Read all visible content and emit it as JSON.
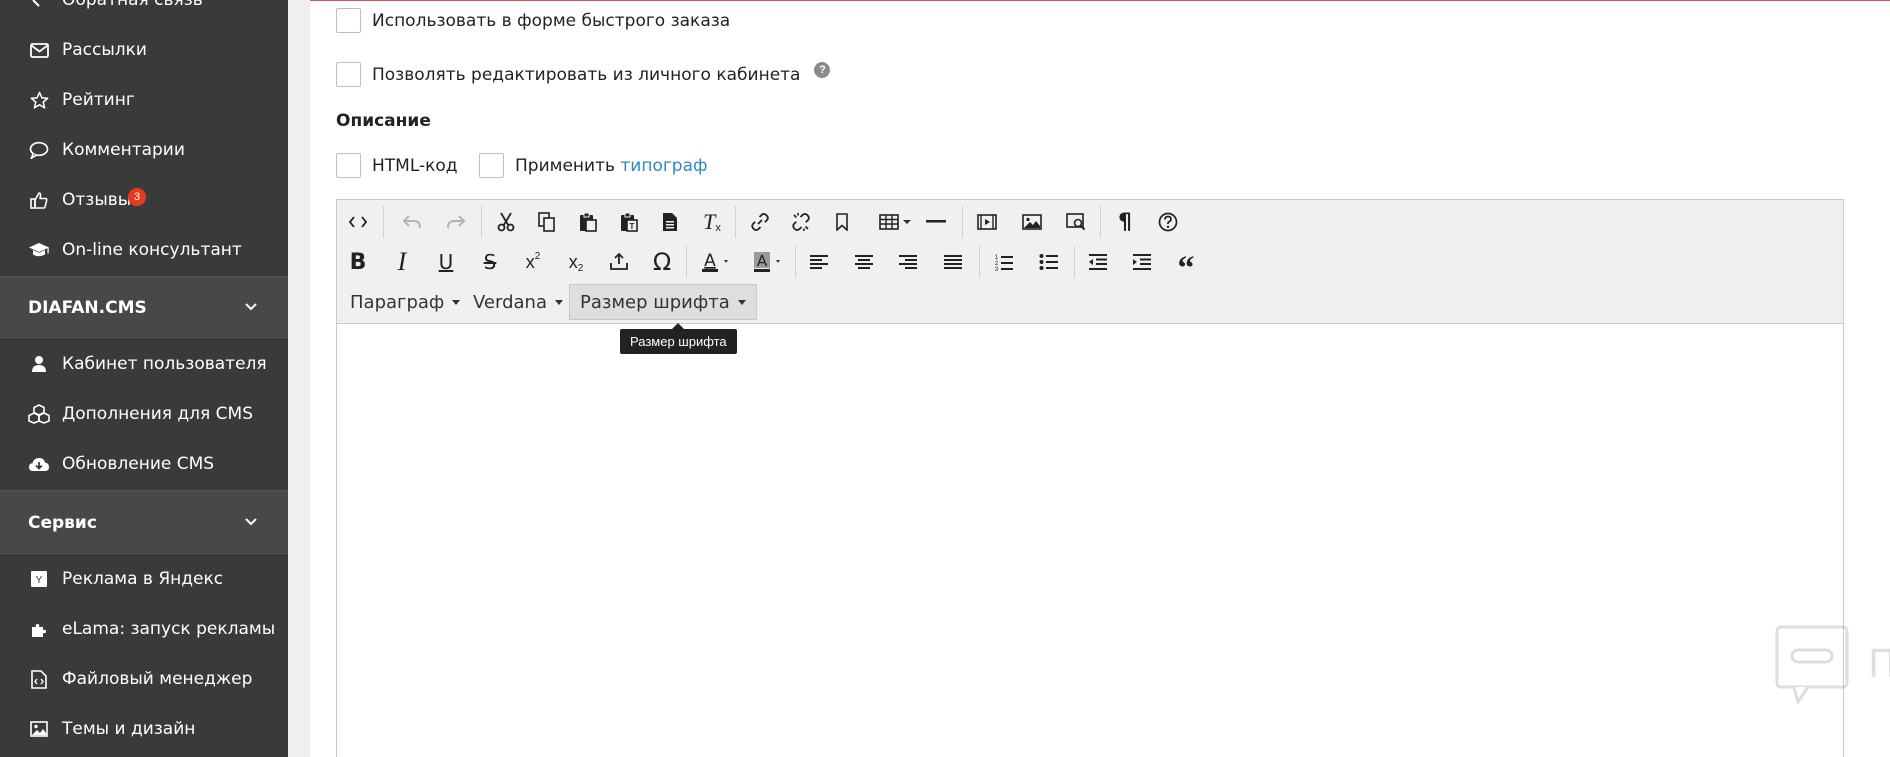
{
  "sidebar": {
    "items_top": [
      {
        "label": "Обратная связь",
        "icon": "feedback-icon"
      },
      {
        "label": "Рассылки",
        "icon": "envelope-icon"
      },
      {
        "label": "Рейтинг",
        "icon": "star-icon"
      },
      {
        "label": "Комментарии",
        "icon": "comment-icon"
      },
      {
        "label": "Отзывы",
        "icon": "thumbs-up-icon",
        "badge": "3"
      },
      {
        "label": "On-line консультант",
        "icon": "graduation-cap-icon"
      }
    ],
    "sections": [
      {
        "title": "DIAFAN.CMS",
        "items": [
          {
            "label": "Кабинет пользователя",
            "icon": "user-icon"
          },
          {
            "label": "Дополнения для CMS",
            "icon": "cubes-icon"
          },
          {
            "label": "Обновление CMS",
            "icon": "cloud-download-icon"
          }
        ]
      },
      {
        "title": "Сервис",
        "items": [
          {
            "label": "Реклама в Яндекс",
            "icon": "yandex-icon"
          },
          {
            "label": "eLama: запуск рекламы",
            "icon": "puzzle-icon"
          },
          {
            "label": "Файловый менеджер",
            "icon": "file-code-icon"
          },
          {
            "label": "Темы и дизайн",
            "icon": "image-icon"
          }
        ]
      }
    ]
  },
  "form": {
    "quick_order_label": "Использовать в форме быстрого заказа",
    "edit_cabinet_label": "Позволять редактировать из личного кабинета",
    "help": "?",
    "description_label": "Описание",
    "html_code_label": "HTML-код",
    "typograph_prefix": "Применить",
    "typograph_link": "типограф"
  },
  "editor": {
    "dropdowns": {
      "format": "Параграф",
      "font": "Verdana",
      "size": "Размер шрифта"
    },
    "tooltip": "Размер шрифта"
  },
  "watermark": {
    "text": "ПАРТНЕРКИН"
  },
  "colors": {
    "sidebar_bg": "#3a3a3a",
    "section_bg": "#484848",
    "badge": "#e53a1e",
    "link": "#2b8ac6",
    "toolbar_bg": "#f0f0f0"
  }
}
